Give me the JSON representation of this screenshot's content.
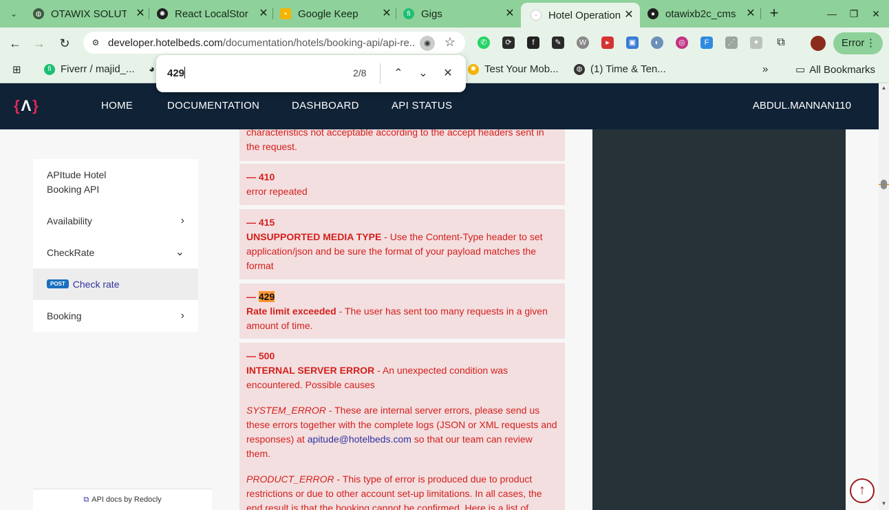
{
  "browser": {
    "tabs": [
      {
        "title": "OTAWIX SOLUTI",
        "favicon": "globe-icon"
      },
      {
        "title": "React LocalStor",
        "favicon": "openai-icon"
      },
      {
        "title": "Google Keep",
        "favicon": "keep-icon"
      },
      {
        "title": "Gigs",
        "favicon": "fiverr-icon"
      },
      {
        "title": "Hotel Operation",
        "favicon": "hotelbeds-icon",
        "active": true
      },
      {
        "title": "otawixb2c_cms",
        "favicon": "github-icon"
      }
    ],
    "url_host": "developer.hotelbeds.com",
    "url_path": "/documentation/hotels/booking-api/api-re...",
    "error_button": "Error",
    "bookmarks": [
      {
        "label": "Fiverr / majid_...",
        "favicon": "fiverr-icon"
      },
      {
        "label": "Test Your Mob...",
        "favicon": "bulb-icon"
      },
      {
        "label": "(1) Time & Ten...",
        "favicon": "globe-icon"
      }
    ],
    "all_bookmarks": "All Bookmarks",
    "find": {
      "query": "429",
      "count": "2/8"
    }
  },
  "site": {
    "logo": "{Λ}",
    "nav": [
      "HOME",
      "DOCUMENTATION",
      "DASHBOARD",
      "API STATUS"
    ],
    "user": "ABDUL.MANNAN110"
  },
  "sidebar": {
    "title": "APItude Hotel Booking API",
    "items": [
      "Availability",
      "CheckRate",
      "Booking"
    ],
    "sub_method": "POST",
    "sub_label": "Check rate",
    "footer": "API docs by Redocly"
  },
  "responses": {
    "top_partial": "characteristics not acceptable according to the accept headers sent in the request.",
    "r410": {
      "code": "— 410",
      "desc": "error repeated"
    },
    "r415": {
      "code": "— 415",
      "name": "UNSUPPORTED MEDIA TYPE",
      "desc": " - Use the Content-Type header to set application/json and be sure the format of your payload matches the format"
    },
    "r429": {
      "dash": "— ",
      "code": "429",
      "name": "Rate limit exceeded",
      "desc": " - The user has sent too many requests in a given amount of time."
    },
    "r500": {
      "code": "— 500",
      "name": "INTERNAL SERVER ERROR",
      "desc": " - An unexpected condition was encountered. Possible causes",
      "sys_name": "SYSTEM_ERROR",
      "sys_desc_1": " - These are internal server errors, please send us these errors together with the complete logs (JSON or XML requests and responses) at ",
      "sys_email": "apitude@hotelbeds.com",
      "sys_desc_2": " so that our team can review them.",
      "prod_name": "PRODUCT_ERROR",
      "prod_desc": " - This type of error is produced due to product restrictions or due to other account set-up limitations. In all cases, the end result is that the booking cannot be confirmed. Here is a list of"
    }
  },
  "colors": {
    "tab_bar": "#8fd19a",
    "nav_bg": "#0f2236",
    "error_text": "#d41f1c",
    "error_bg": "#f3dfe0",
    "find_highlight": "#ff9632",
    "code_panel": "#263238"
  }
}
